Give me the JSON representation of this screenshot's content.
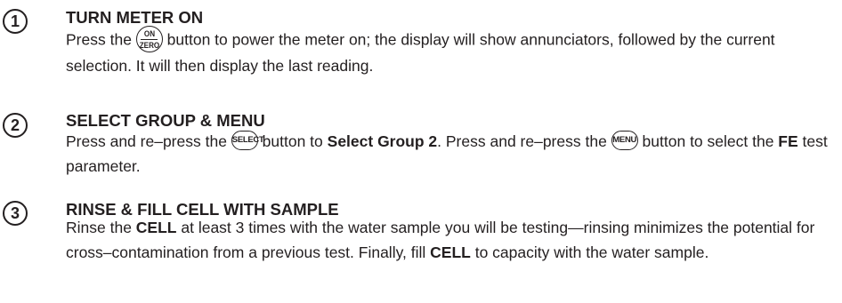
{
  "steps": [
    {
      "number": "1",
      "title": "TURN METER ON",
      "body": {
        "t1": "Press the ",
        "icon": {
          "top": "ON",
          "bottom": "ZERO"
        },
        "t2": " button to power the meter on; the display will show annunciators, followed by the current selection. It will then display the last reading."
      }
    },
    {
      "number": "2",
      "title": "SELECT GROUP & MENU",
      "body": {
        "t1": "Press and re–press the ",
        "icon1": "SELECT",
        "t2": " button to ",
        "b1": "Select Group 2",
        "t3": ". Press and re–press the ",
        "icon2": "MENU",
        "t4": " button to select the ",
        "b2": "FE",
        "t5": " test parameter."
      }
    },
    {
      "number": "3",
      "title": "RINSE & FILL CELL WITH SAMPLE",
      "body": {
        "t1": "Rinse the ",
        "b1": "CELL",
        "t2": " at least 3 times with the water sample you will be testing—rinsing minimizes the potential for cross–contamination from a previous test. Finally, fill ",
        "b2": "CELL",
        "t3": " to capacity with the water sample."
      }
    }
  ]
}
